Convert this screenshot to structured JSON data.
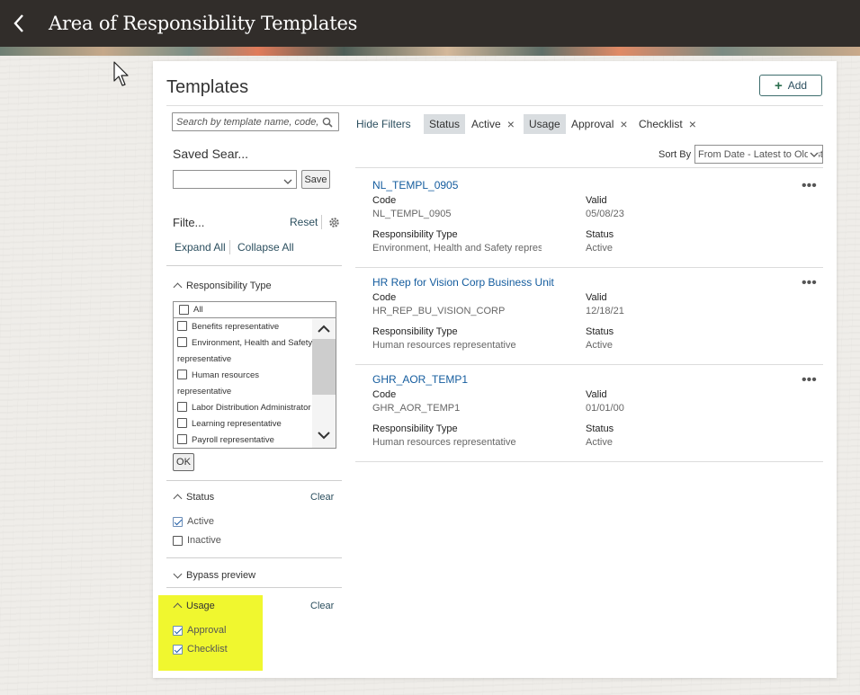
{
  "header": {
    "title": "Area of Responsibility Templates"
  },
  "page": {
    "title": "Templates",
    "add_label": "Add"
  },
  "search": {
    "placeholder": "Search by template name, code, ..."
  },
  "hide_filters_label": "Hide Filters",
  "active_filters": [
    {
      "label": "Status",
      "values": [
        "Active"
      ]
    },
    {
      "label": "Usage",
      "values": [
        "Approval",
        "Checklist"
      ]
    }
  ],
  "saved_search": {
    "label": "Saved Sear...",
    "value": "",
    "save_label": "Save"
  },
  "filters": {
    "label": "Filte...",
    "reset_label": "Reset",
    "expand_all": "Expand All",
    "collapse_all": "Collapse All"
  },
  "responsibility_type": {
    "title": "Responsibility Type",
    "all_label": "All",
    "items": [
      {
        "label": "Benefits representative",
        "checked": false
      },
      {
        "label": "Environment, Health and Safety representative",
        "checked": false
      },
      {
        "label": "Human resources representative",
        "checked": false
      },
      {
        "label": "Labor Distribution Administrator",
        "checked": false
      },
      {
        "label": "Learning representative",
        "checked": false
      },
      {
        "label": "Payroll representative",
        "checked": false
      }
    ],
    "ok_label": "OK"
  },
  "status_filter": {
    "title": "Status",
    "clear_label": "Clear",
    "options": [
      {
        "label": "Active",
        "checked": true
      },
      {
        "label": "Inactive",
        "checked": false
      }
    ]
  },
  "bypass_preview": {
    "title": "Bypass preview"
  },
  "usage_filter": {
    "title": "Usage",
    "clear_label": "Clear",
    "options": [
      {
        "label": "Approval",
        "checked": true
      },
      {
        "label": "Checklist",
        "checked": true
      }
    ]
  },
  "sort": {
    "label": "Sort By",
    "value": "From Date - Latest to Oldest"
  },
  "field_labels": {
    "code": "Code",
    "valid": "Valid",
    "responsibility_type": "Responsibility Type",
    "status": "Status"
  },
  "results": [
    {
      "name": "NL_TEMPL_0905",
      "code": "NL_TEMPL_0905",
      "valid": "05/08/23",
      "responsibility_type": "Environment, Health and Safety representative",
      "status": "Active"
    },
    {
      "name": "HR Rep for Vision Corp Business Unit",
      "code": "HR_REP_BU_VISION_CORP",
      "valid": "12/18/21",
      "responsibility_type": "Human resources representative",
      "status": "Active"
    },
    {
      "name": "GHR_AOR_TEMP1",
      "code": "GHR_AOR_TEMP1",
      "valid": "01/01/00",
      "responsibility_type": "Human resources representative",
      "status": "Active"
    }
  ],
  "colors": {
    "header_bg": "#312d2a",
    "link": "#145c9e",
    "highlight": "#f0f72f"
  }
}
